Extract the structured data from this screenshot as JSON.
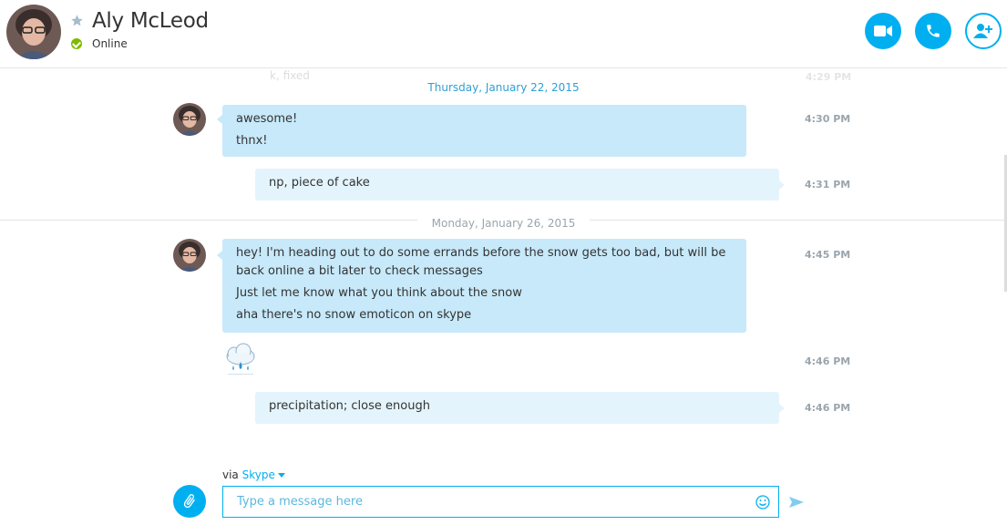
{
  "header": {
    "contact_name": "Aly McLeod",
    "presence": "Online",
    "buttons": [
      "video-call",
      "audio-call",
      "add-people"
    ]
  },
  "conversation": {
    "faded_top_text": "k, fixed",
    "faded_top_time": "4:29 PM",
    "date1": "Thursday, January 22, 2015",
    "date2": "Monday, January 26, 2015",
    "messages": [
      {
        "direction": "incoming",
        "lines": [
          "awesome!",
          "thnx!"
        ],
        "time": "4:30 PM"
      },
      {
        "direction": "outgoing",
        "lines": [
          "np, piece of cake"
        ],
        "time": "4:31 PM"
      },
      {
        "direction": "incoming",
        "lines": [
          "hey! I'm heading out to do some errands before the snow gets too bad, but will be back online a bit later to check messages",
          "Just let me know what you think about the snow",
          "aha there's no snow emoticon on skype"
        ],
        "time": "4:45 PM"
      },
      {
        "direction": "incoming",
        "emoticon": "rain-cloud",
        "time": "4:46 PM"
      },
      {
        "direction": "outgoing",
        "lines": [
          "precipitation; close enough"
        ],
        "time": "4:46 PM"
      }
    ]
  },
  "composer": {
    "via_prefix": "via",
    "via_service": "Skype",
    "placeholder": "Type a message here"
  },
  "colors": {
    "accent": "#00aff0",
    "incoming_bubble": "#c7e9fa",
    "outgoing_bubble": "#e4f4fc",
    "online": "#7fba00"
  }
}
